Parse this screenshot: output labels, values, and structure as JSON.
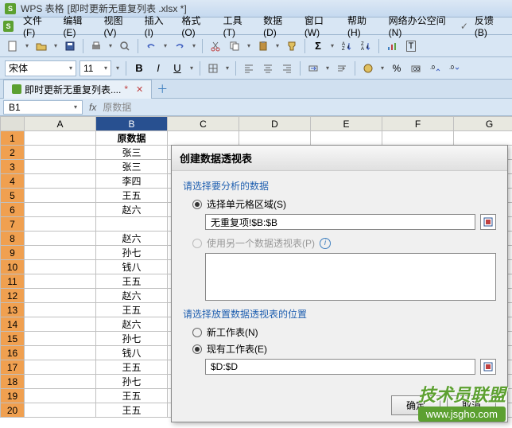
{
  "titlebar": {
    "app": "WPS 表格",
    "doc": "[即时更新无重复列表 .xlsx *]"
  },
  "menubar": [
    "文件(F)",
    "编辑(E)",
    "视图(V)",
    "插入(I)",
    "格式(O)",
    "工具(T)",
    "数据(D)",
    "窗口(W)",
    "帮助(H)",
    "网络办公空间(N)",
    "反馈(B)"
  ],
  "font": {
    "name": "宋体",
    "size": "11"
  },
  "tab": {
    "name": "即时更新无重复列表....",
    "close": "✕",
    "add": "＋"
  },
  "namebox": "B1",
  "formula_hint": "原数据",
  "columns": [
    "A",
    "B",
    "C",
    "D",
    "E",
    "F",
    "G"
  ],
  "rows": [
    1,
    2,
    3,
    4,
    5,
    6,
    7,
    8,
    9,
    10,
    11,
    12,
    13,
    14,
    15,
    16,
    17,
    18,
    19,
    20
  ],
  "header_b": "原数据",
  "col_b_data": [
    "",
    "张三",
    "张三",
    "李四",
    "王五",
    "赵六",
    "",
    "赵六",
    "孙七",
    "钱八",
    "王五",
    "赵六",
    "王五",
    "赵六",
    "孙七",
    "钱八",
    "王五",
    "孙七",
    "王五",
    "王五"
  ],
  "dialog": {
    "title": "创建数据透视表",
    "section1": "请选择要分析的数据",
    "opt1": "选择单元格区域(S)",
    "input1": "无重复项!$B:$B",
    "opt2": "使用另一个数据透视表(P)",
    "section2": "请选择放置数据透视表的位置",
    "opt3": "新工作表(N)",
    "opt4": "现有工作表(E)",
    "input2": "$D:$D",
    "ok": "确定",
    "cancel": "取消"
  },
  "watermark": {
    "text": "技术员联盟",
    "url": "www.jsgho.com"
  }
}
